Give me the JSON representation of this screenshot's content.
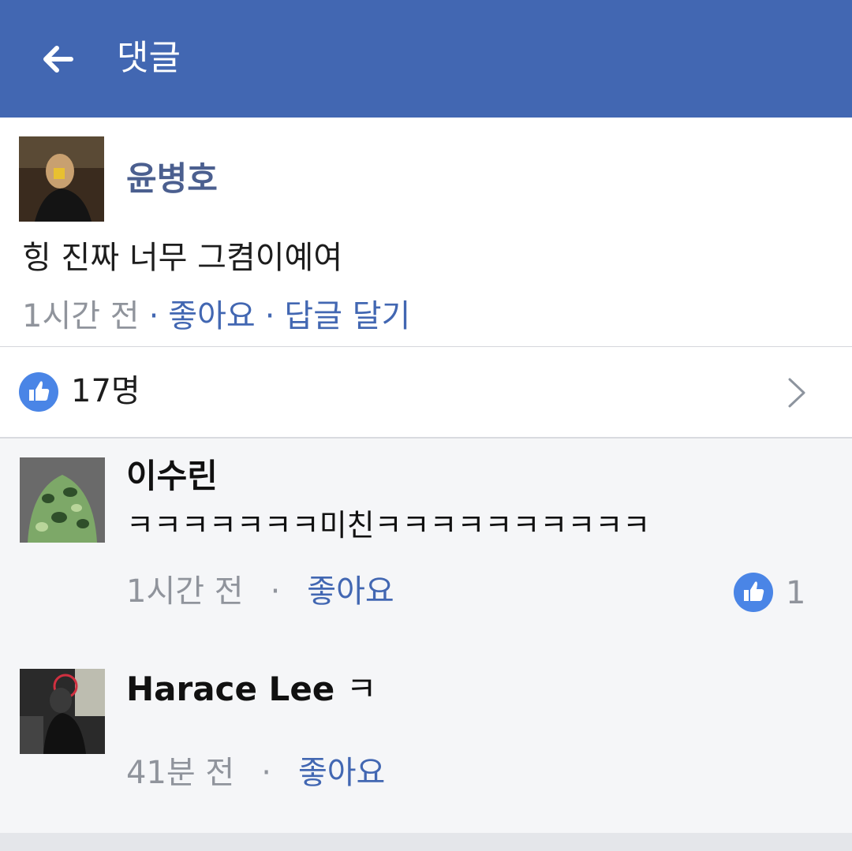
{
  "header": {
    "title": "댓글",
    "back_icon": "arrow-left-icon",
    "background": "#4267b2"
  },
  "post": {
    "author": "윤병호",
    "text": "힝 진짜 너무 그켬이예여",
    "time": "1시간 전",
    "like_label": "좋아요",
    "reply_label": "답글 달기"
  },
  "likes": {
    "count_label": "17명",
    "icon": "thumbs-up-icon",
    "chevron_icon": "chevron-right-icon"
  },
  "replies": [
    {
      "author": "이수린",
      "text": "ㅋㅋㅋㅋㅋㅋㅋ미친ㅋㅋㅋㅋㅋㅋㅋㅋㅋㅋ",
      "time": "1시간 전",
      "like_label": "좋아요",
      "like_count": "1"
    },
    {
      "author": "Harace Lee",
      "text": "ㅋ",
      "time": "41분 전",
      "like_label": "좋아요"
    }
  ],
  "colors": {
    "link": "#4267b2",
    "meta_grey": "#90949c",
    "like_blue": "#4a85e6",
    "reply_background": "#f5f6f8"
  }
}
